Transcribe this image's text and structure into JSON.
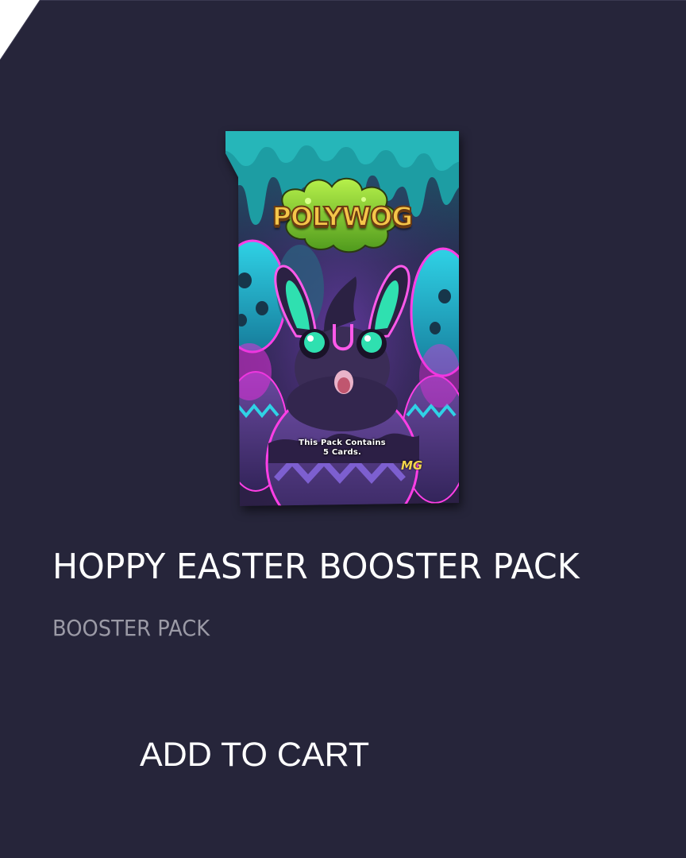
{
  "product": {
    "title": "HOPPY EASTER BOOSTER PACK",
    "category": "BOOSTER PACK",
    "add_to_cart_label": "ADD TO CART"
  },
  "pack_art": {
    "logo": "POLYWOG",
    "contents_line1": "This Pack Contains",
    "contents_line2": "5 Cards.",
    "brand_mark": "MG"
  },
  "colors": {
    "card_background": "#26253a",
    "title_text": "#ffffff",
    "subtitle_text": "#9b9aa6",
    "pack_teal": "#1f8e93",
    "pack_magenta": "#e02fd8",
    "pack_purple": "#3b2a5c"
  }
}
